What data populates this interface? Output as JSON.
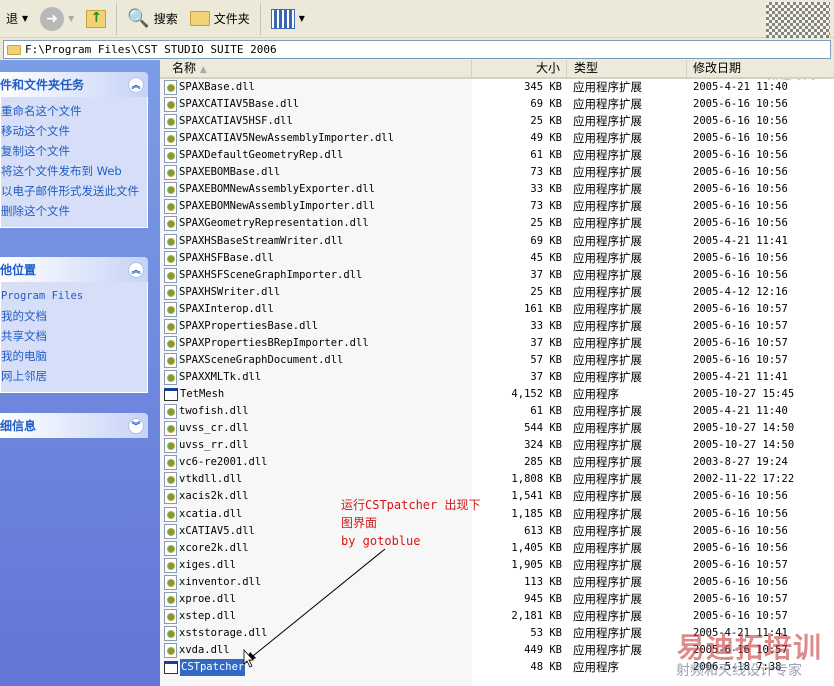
{
  "toolbar": {
    "back": "退",
    "search": "搜索",
    "folders": "文件夹"
  },
  "address": "F:\\Program Files\\CST STUDIO SUITE 2006",
  "left_panel": {
    "tasks": {
      "title": "件和文件夹任务",
      "items": [
        "重命名这个文件",
        "移动这个文件",
        "复制这个文件",
        "将这个文件发布到 Web",
        "以电子邮件形式发送此文件",
        "删除这个文件"
      ]
    },
    "places": {
      "title": "他位置",
      "items": [
        "Program Files",
        "我的文档",
        "共享文档",
        "我的电脑",
        "网上邻居"
      ]
    },
    "details": {
      "title": "细信息"
    }
  },
  "columns": {
    "name": "名称",
    "size": "大小",
    "type": "类型",
    "date": "修改日期"
  },
  "files": [
    {
      "name": "SPAXBase.dll",
      "size": "345 KB",
      "type": "应用程序扩展",
      "date": "2005-4-21 11:40",
      "kind": "dll"
    },
    {
      "name": "SPAXCATIAV5Base.dll",
      "size": "69 KB",
      "type": "应用程序扩展",
      "date": "2005-6-16 10:56",
      "kind": "dll"
    },
    {
      "name": "SPAXCATIAV5HSF.dll",
      "size": "25 KB",
      "type": "应用程序扩展",
      "date": "2005-6-16 10:56",
      "kind": "dll"
    },
    {
      "name": "SPAXCATIAV5NewAssemblyImporter.dll",
      "size": "49 KB",
      "type": "应用程序扩展",
      "date": "2005-6-16 10:56",
      "kind": "dll"
    },
    {
      "name": "SPAXDefaultGeometryRep.dll",
      "size": "61 KB",
      "type": "应用程序扩展",
      "date": "2005-6-16 10:56",
      "kind": "dll"
    },
    {
      "name": "SPAXEBOMBase.dll",
      "size": "73 KB",
      "type": "应用程序扩展",
      "date": "2005-6-16 10:56",
      "kind": "dll"
    },
    {
      "name": "SPAXEBOMNewAssemblyExporter.dll",
      "size": "33 KB",
      "type": "应用程序扩展",
      "date": "2005-6-16 10:56",
      "kind": "dll"
    },
    {
      "name": "SPAXEBOMNewAssemblyImporter.dll",
      "size": "73 KB",
      "type": "应用程序扩展",
      "date": "2005-6-16 10:56",
      "kind": "dll"
    },
    {
      "name": "SPAXGeometryRepresentation.dll",
      "size": "25 KB",
      "type": "应用程序扩展",
      "date": "2005-6-16 10:56",
      "kind": "dll"
    },
    {
      "name": "SPAXHSBaseStreamWriter.dll",
      "size": "69 KB",
      "type": "应用程序扩展",
      "date": "2005-4-21 11:41",
      "kind": "dll"
    },
    {
      "name": "SPAXHSFBase.dll",
      "size": "45 KB",
      "type": "应用程序扩展",
      "date": "2005-6-16 10:56",
      "kind": "dll"
    },
    {
      "name": "SPAXHSFSceneGraphImporter.dll",
      "size": "37 KB",
      "type": "应用程序扩展",
      "date": "2005-6-16 10:56",
      "kind": "dll"
    },
    {
      "name": "SPAXHSWriter.dll",
      "size": "25 KB",
      "type": "应用程序扩展",
      "date": "2005-4-12 12:16",
      "kind": "dll"
    },
    {
      "name": "SPAXInterop.dll",
      "size": "161 KB",
      "type": "应用程序扩展",
      "date": "2005-6-16 10:57",
      "kind": "dll"
    },
    {
      "name": "SPAXPropertiesBase.dll",
      "size": "33 KB",
      "type": "应用程序扩展",
      "date": "2005-6-16 10:57",
      "kind": "dll"
    },
    {
      "name": "SPAXPropertiesBRepImporter.dll",
      "size": "37 KB",
      "type": "应用程序扩展",
      "date": "2005-6-16 10:57",
      "kind": "dll"
    },
    {
      "name": "SPAXSceneGraphDocument.dll",
      "size": "57 KB",
      "type": "应用程序扩展",
      "date": "2005-6-16 10:57",
      "kind": "dll"
    },
    {
      "name": "SPAXXMLTk.dll",
      "size": "37 KB",
      "type": "应用程序扩展",
      "date": "2005-4-21 11:41",
      "kind": "dll"
    },
    {
      "name": "TetMesh",
      "size": "4,152 KB",
      "type": "应用程序",
      "date": "2005-10-27 15:45",
      "kind": "exe"
    },
    {
      "name": "twofish.dll",
      "size": "61 KB",
      "type": "应用程序扩展",
      "date": "2005-4-21 11:40",
      "kind": "dll"
    },
    {
      "name": "uvss_cr.dll",
      "size": "544 KB",
      "type": "应用程序扩展",
      "date": "2005-10-27 14:50",
      "kind": "dll"
    },
    {
      "name": "uvss_rr.dll",
      "size": "324 KB",
      "type": "应用程序扩展",
      "date": "2005-10-27 14:50",
      "kind": "dll"
    },
    {
      "name": "vc6-re2001.dll",
      "size": "285 KB",
      "type": "应用程序扩展",
      "date": "2003-8-27 19:24",
      "kind": "dll"
    },
    {
      "name": "vtkdll.dll",
      "size": "1,808 KB",
      "type": "应用程序扩展",
      "date": "2002-11-22 17:22",
      "kind": "dll"
    },
    {
      "name": "xacis2k.dll",
      "size": "1,541 KB",
      "type": "应用程序扩展",
      "date": "2005-6-16 10:56",
      "kind": "dll"
    },
    {
      "name": "xcatia.dll",
      "size": "1,185 KB",
      "type": "应用程序扩展",
      "date": "2005-6-16 10:56",
      "kind": "dll"
    },
    {
      "name": "xCATIAV5.dll",
      "size": "613 KB",
      "type": "应用程序扩展",
      "date": "2005-6-16 10:56",
      "kind": "dll"
    },
    {
      "name": "xcore2k.dll",
      "size": "1,405 KB",
      "type": "应用程序扩展",
      "date": "2005-6-16 10:56",
      "kind": "dll"
    },
    {
      "name": "xiges.dll",
      "size": "1,905 KB",
      "type": "应用程序扩展",
      "date": "2005-6-16 10:57",
      "kind": "dll"
    },
    {
      "name": "xinventor.dll",
      "size": "113 KB",
      "type": "应用程序扩展",
      "date": "2005-6-16 10:56",
      "kind": "dll"
    },
    {
      "name": "xproe.dll",
      "size": "945 KB",
      "type": "应用程序扩展",
      "date": "2005-6-16 10:57",
      "kind": "dll"
    },
    {
      "name": "xstep.dll",
      "size": "2,181 KB",
      "type": "应用程序扩展",
      "date": "2005-6-16 10:57",
      "kind": "dll"
    },
    {
      "name": "xststorage.dll",
      "size": "53 KB",
      "type": "应用程序扩展",
      "date": "2005-4-21 11:41",
      "kind": "dll"
    },
    {
      "name": "xvda.dll",
      "size": "449 KB",
      "type": "应用程序扩展",
      "date": "2005-6-16 10:57",
      "kind": "dll"
    },
    {
      "name": "CSTpatcher",
      "size": "48 KB",
      "type": "应用程序",
      "date": "2006-5-18 7:38",
      "kind": "exe",
      "selected": true
    }
  ],
  "annotation": {
    "line1": "运行CSTpatcher 出现下",
    "line2": "图界面",
    "line3": "by gotoblue",
    "color": "#d01818"
  },
  "watermarks": {
    "wechat": "微信联系",
    "brand": "易迪拓培训",
    "slogan": "射频和天线设计专家"
  }
}
